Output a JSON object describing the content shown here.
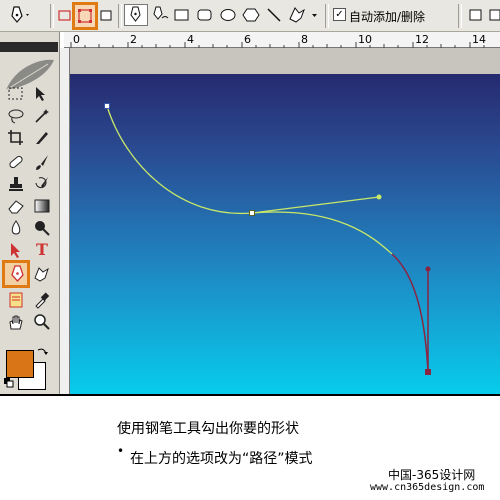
{
  "options_bar": {
    "checkbox_label": "自动添加/删除",
    "checkbox_checked": true,
    "checkbox_mark": "✓",
    "active_mode": "paths",
    "accent_color": "#e07a12",
    "icons": [
      "pen-tool-icon",
      "shape-layers-icon",
      "paths-mode-icon",
      "fill-pixels-icon",
      "pen-icon",
      "freeform-pen-icon",
      "rectangle-icon",
      "rounded-rectangle-icon",
      "ellipse-icon",
      "polygon-icon",
      "line-icon",
      "custom-shape-icon",
      "add-to-path-icon",
      "subtract-path-icon"
    ]
  },
  "ruler": {
    "labels": [
      "0",
      "2",
      "4",
      "6",
      "8",
      "10",
      "12",
      "14"
    ]
  },
  "toolbox": {
    "type_tool_glyph": "T",
    "foreground_color": "#d97417",
    "background_color": "#ffffff",
    "highlighted_tool": "pen-tool"
  },
  "canvas": {
    "gradient_top": "#262a6f",
    "gradient_bottom": "#07ccec",
    "path_color": "#c8e86a",
    "path_segment_color": "#8a2440"
  },
  "caption": {
    "line1": "使用钢笔工具勾出你要的形状",
    "bullet": "•",
    "line2": "在上方的选项改为“路径”模式",
    "watermark1": "中国-365设计网",
    "watermark2": "www.cn365design.com"
  }
}
